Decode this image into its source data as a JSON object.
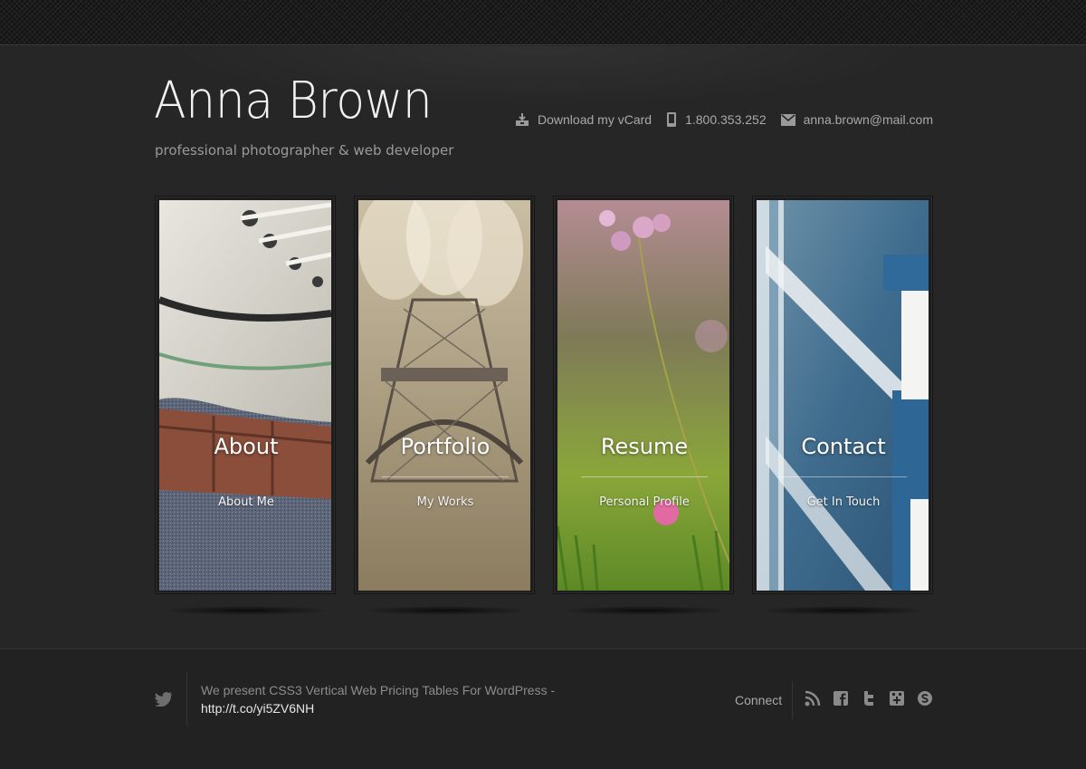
{
  "header": {
    "title": "Anna Brown",
    "tagline": "professional photographer & web developer"
  },
  "contact": {
    "vcard_label": "Download my vCard",
    "phone": "1.800.353.252",
    "email": "anna.brown@mail.com"
  },
  "cards": [
    {
      "title": "About",
      "subtitle": "About Me",
      "image": "sneaker-photo"
    },
    {
      "title": "Portfolio",
      "subtitle": "My Works",
      "image": "eiffel-tower-photo"
    },
    {
      "title": "Resume",
      "subtitle": "Personal Profile",
      "image": "flower-photo"
    },
    {
      "title": "Contact",
      "subtitle": "Get In Touch",
      "image": "railing-photo"
    }
  ],
  "footer": {
    "tweet_text": "We present CSS3 Vertical Web Pricing Tables For WordPress - ",
    "tweet_link": "http://t.co/yi5ZV6NH",
    "connect_label": "Connect",
    "social_icons": [
      "rss-icon",
      "facebook-icon",
      "twitter-icon",
      "google-plus-icon",
      "skype-icon"
    ]
  },
  "colors": {
    "background": "#262626",
    "footer": "#222222",
    "title": "#f2f2f2",
    "text": "#a9a9a9"
  }
}
